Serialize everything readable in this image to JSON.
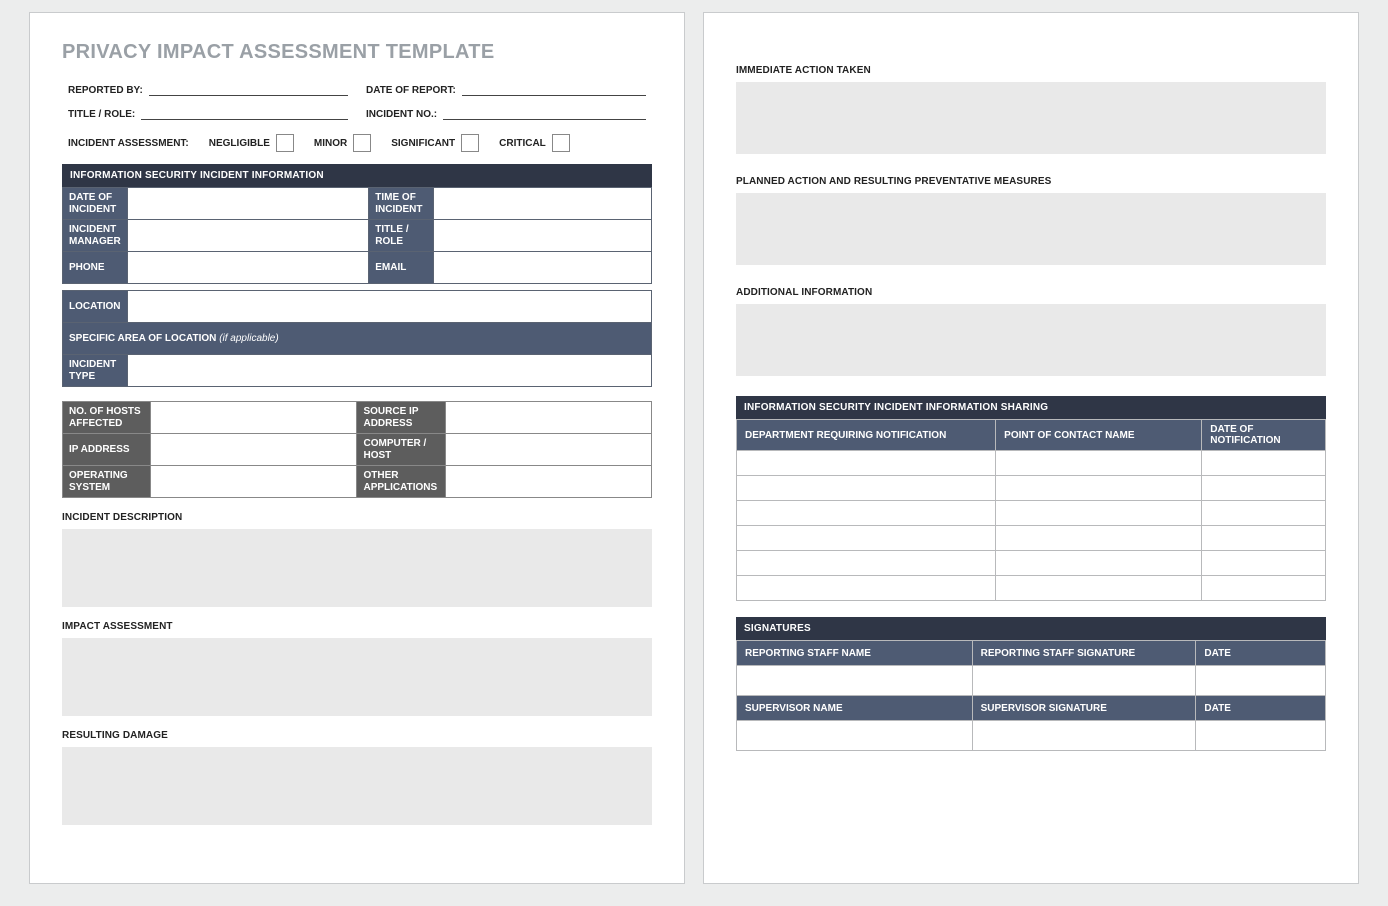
{
  "title": "PRIVACY IMPACT ASSESSMENT TEMPLATE",
  "header": {
    "reported_by_label": "REPORTED BY:",
    "date_of_report_label": "DATE OF REPORT:",
    "title_role_label": "TITLE / ROLE:",
    "incident_no_label": "INCIDENT NO.:",
    "assessment_label": "INCIDENT ASSESSMENT:",
    "levels": {
      "negligible": "NEGLIGIBLE",
      "minor": "MINOR",
      "significant": "SIGNIFICANT",
      "critical": "CRITICAL"
    }
  },
  "section_info_header": "INFORMATION SECURITY INCIDENT INFORMATION",
  "info": {
    "date_of_incident": "DATE OF INCIDENT",
    "time_of_incident": "TIME OF INCIDENT",
    "incident_manager": "INCIDENT MANAGER",
    "title_role": "TITLE / ROLE",
    "phone": "PHONE",
    "email": "EMAIL",
    "location": "LOCATION",
    "specific_area_label": "SPECIFIC AREA OF LOCATION",
    "specific_area_note": "(if applicable)",
    "incident_type": "INCIDENT TYPE"
  },
  "hosts": {
    "no_hosts": "NO. OF HOSTS AFFECTED",
    "source_ip": "SOURCE IP ADDRESS",
    "ip_address": "IP ADDRESS",
    "computer_host": "COMPUTER / HOST",
    "os": "OPERATING SYSTEM",
    "other_apps": "OTHER APPLICATIONS"
  },
  "narrative": {
    "incident_description": "INCIDENT DESCRIPTION",
    "impact_assessment": "IMPACT ASSESSMENT",
    "resulting_damage": "RESULTING DAMAGE",
    "immediate_action": "IMMEDIATE ACTION TAKEN",
    "planned_action": "PLANNED ACTION AND RESULTING PREVENTATIVE MEASURES",
    "additional_info": "ADDITIONAL INFORMATION"
  },
  "sharing_header": "INFORMATION SECURITY INCIDENT INFORMATION SHARING",
  "sharing_cols": {
    "dept": "DEPARTMENT REQUIRING NOTIFICATION",
    "poc": "POINT OF CONTACT NAME",
    "date": "DATE OF NOTIFICATION"
  },
  "signatures_header": "SIGNATURES",
  "signatures": {
    "reporting_name": "REPORTING STAFF NAME",
    "reporting_sig": "REPORTING STAFF SIGNATURE",
    "date": "DATE",
    "supervisor_name": "SUPERVISOR NAME",
    "supervisor_sig": "SUPERVISOR SIGNATURE"
  }
}
